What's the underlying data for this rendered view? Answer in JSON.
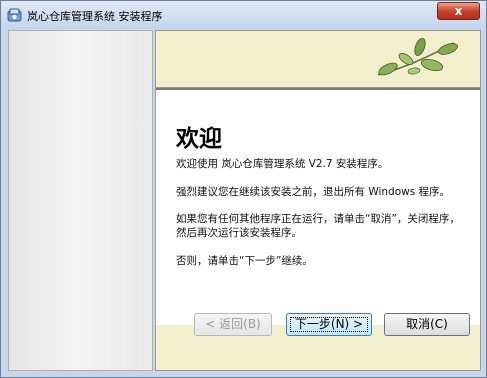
{
  "window": {
    "title": "岚心仓库管理系统 安装程序",
    "close_label": "x"
  },
  "page": {
    "heading": "欢迎",
    "paragraphs": [
      "欢迎使用 岚心仓库管理系统 V2.7 安装程序。",
      "强烈建议您在继续该安装之前，退出所有 Windows 程序。",
      "如果您有任何其他程序正在运行，请单击“取消”，关闭程序，然后再次运行该安装程序。",
      "否则，请单击“下一步”继续。"
    ]
  },
  "buttons": {
    "back": "< 返回(B)",
    "next": "下一步(N) >",
    "cancel": "取消(C)"
  },
  "icons": {
    "app": "installer-icon",
    "banner": "leaf-branch-icon"
  },
  "colors": {
    "banner_bg": "#f2efcf",
    "leaf_green": "#5f8c3a"
  }
}
